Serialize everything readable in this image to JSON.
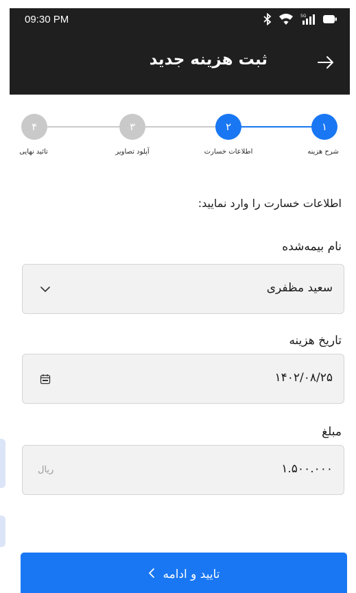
{
  "status_bar": {
    "time": "09:30 PM",
    "icons": [
      "bluetooth-icon",
      "wifi-icon",
      "5g-signal-icon",
      "battery-icon"
    ]
  },
  "header": {
    "title": "ثبت هزینه جدید",
    "back_icon": "arrow-right-icon"
  },
  "stepper": {
    "steps": [
      {
        "number": "۱",
        "label": "شرح هزینه",
        "state": "done"
      },
      {
        "number": "۲",
        "label": "اطلاعات خسارت",
        "state": "current"
      },
      {
        "number": "۳",
        "label": "آپلود تصاویر",
        "state": "todo"
      },
      {
        "number": "۴",
        "label": "تائید نهایی",
        "state": "todo"
      }
    ]
  },
  "form": {
    "prompt": "اطلاعات خسارت را وارد نمایید:",
    "insured_name": {
      "label": "نام بیمه‌شده",
      "value": "سعید مظفری",
      "icon": "chevron-down-icon"
    },
    "expense_date": {
      "label": "تاریخ هزینه",
      "value": "۱۴۰۲/۰۸/۲۵",
      "icon": "calendar-icon"
    },
    "amount": {
      "label": "مبلغ",
      "value": "۱.۵۰۰.۰۰۰",
      "unit": "ریال"
    }
  },
  "actions": {
    "confirm_label": "تایید و ادامه",
    "confirm_icon": "chevron-left-icon"
  },
  "colors": {
    "primary": "#1977f3",
    "appbar": "#1f1f1f",
    "inactive_step": "#c9c9c9",
    "field_bg": "#f2f2f2"
  }
}
